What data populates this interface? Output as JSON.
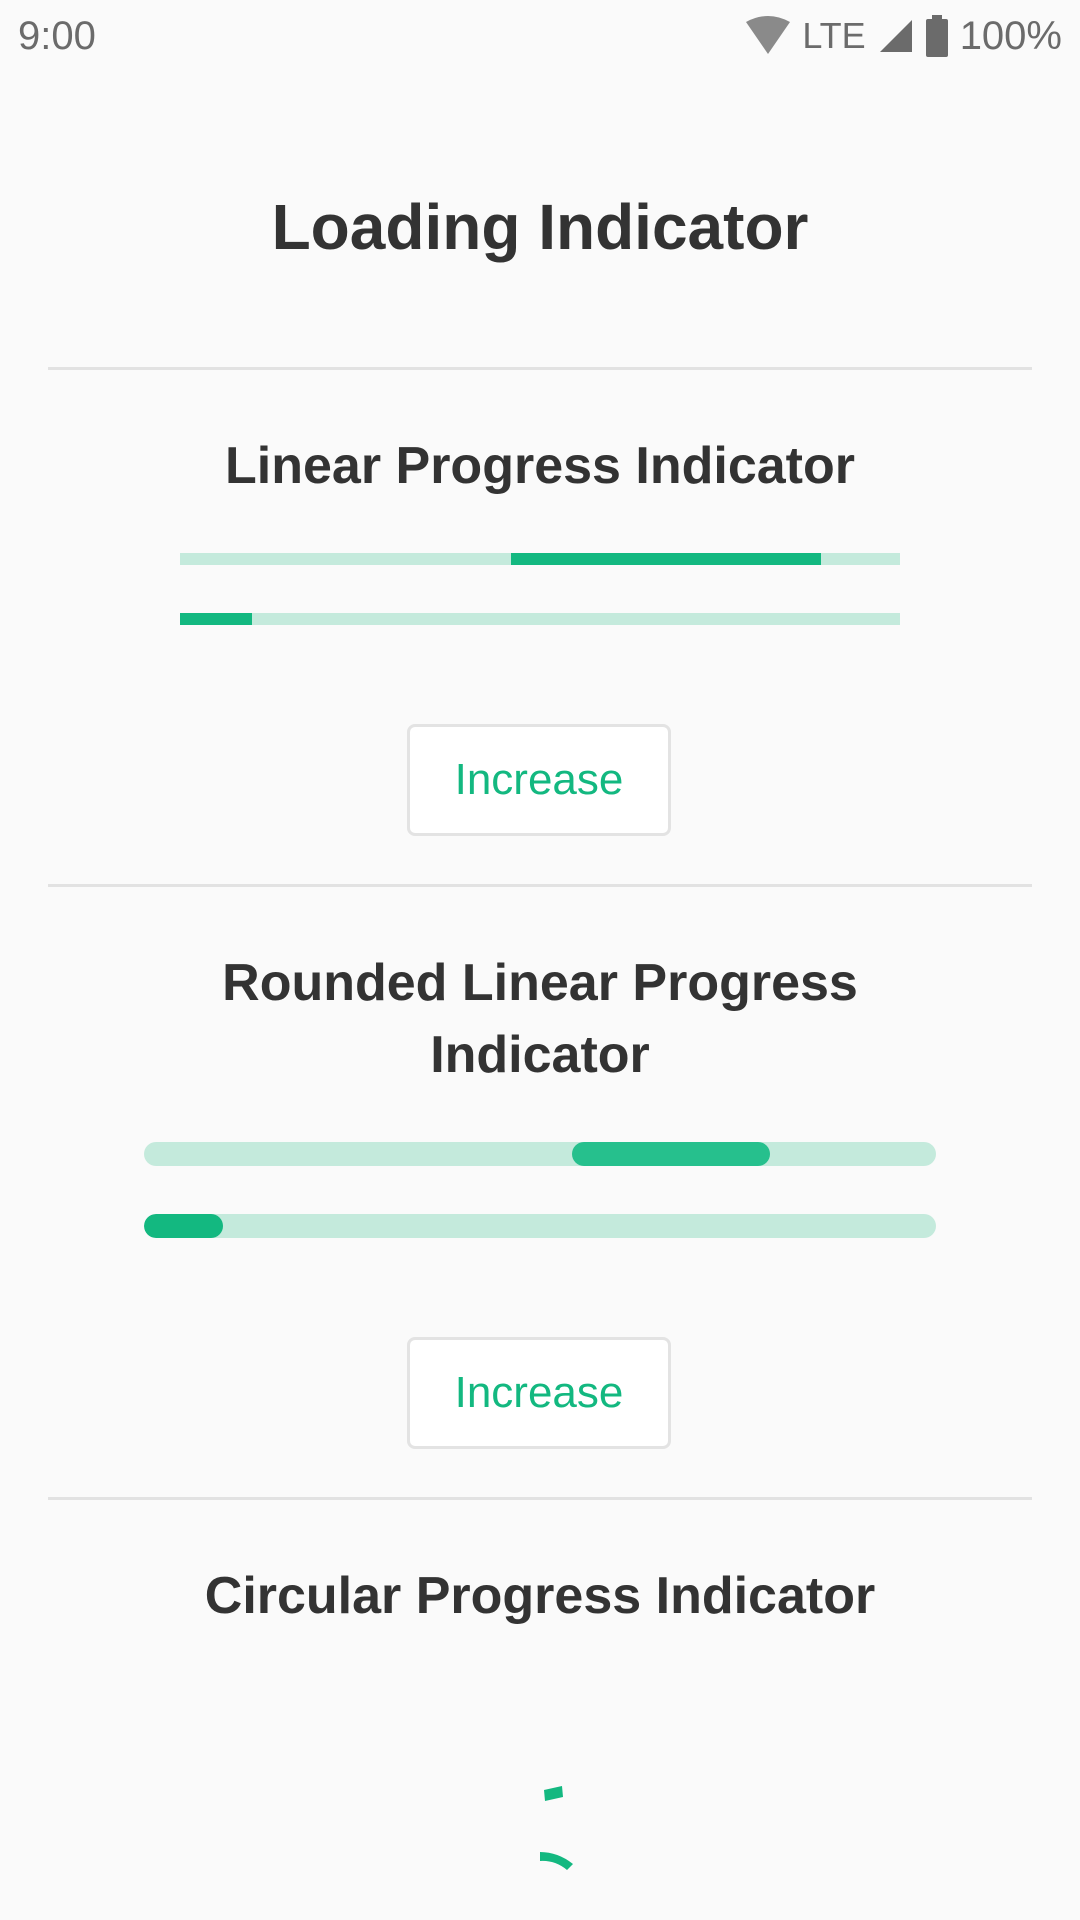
{
  "status_bar": {
    "time": "9:00",
    "network": "LTE",
    "battery": "100%",
    "icons": [
      "wifi-icon",
      "cell-signal-icon",
      "battery-icon"
    ]
  },
  "page": {
    "title": "Loading Indicator"
  },
  "colors": {
    "accent": "#13b880",
    "track": "#c4eadc",
    "text": "#333333",
    "divider": "#e2e2e2",
    "background": "#fafafa"
  },
  "sections": {
    "linear": {
      "title": "Linear Progress Indicator",
      "indeterminate_segment": [
        0.46,
        0.89
      ],
      "determinate_value": 0.1,
      "button_label": "Increase"
    },
    "rounded": {
      "title": "Rounded Linear Progress Indicator",
      "indeterminate_segment": [
        0.54,
        0.79
      ],
      "determinate_value": 0.1,
      "button_label": "Increase"
    },
    "circular": {
      "title": "Circular Progress Indicator"
    }
  }
}
